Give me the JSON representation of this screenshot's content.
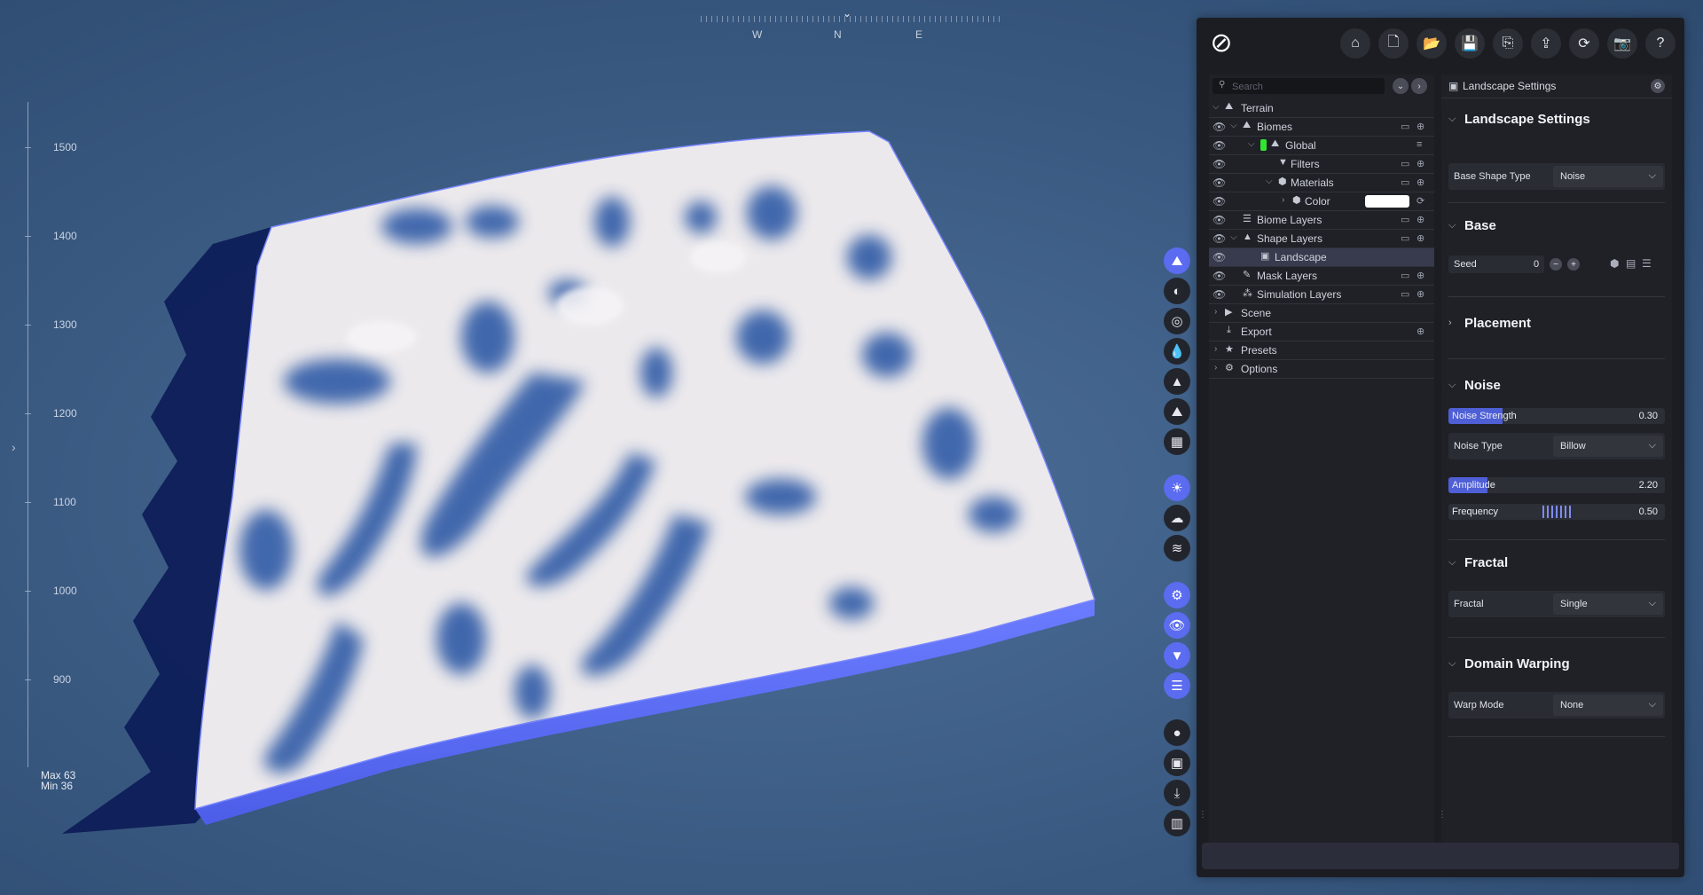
{
  "viewport": {
    "compass": {
      "west": "W",
      "north": "N",
      "east": "E"
    },
    "ruler_ticks": [
      "1500",
      "1400",
      "1300",
      "1200",
      "1100",
      "1000",
      "900"
    ],
    "max_label": "Max 63",
    "min_label": "Min 36"
  },
  "toolbar": {
    "buttons": [
      "home-icon",
      "new-file-icon",
      "open-folder-icon",
      "save-icon",
      "save-as-icon",
      "export-icon",
      "refresh-icon",
      "camera-icon",
      "help-icon"
    ]
  },
  "tree": {
    "search_placeholder": "Search",
    "items": [
      {
        "label": "Terrain"
      },
      {
        "label": "Biomes"
      },
      {
        "label": "Global"
      },
      {
        "label": "Filters"
      },
      {
        "label": "Materials"
      },
      {
        "label": "Color"
      },
      {
        "label": "Biome Layers"
      },
      {
        "label": "Shape Layers"
      },
      {
        "label": "Landscape"
      },
      {
        "label": "Mask Layers"
      },
      {
        "label": "Simulation Layers"
      },
      {
        "label": "Scene"
      },
      {
        "label": "Export"
      },
      {
        "label": "Presets"
      },
      {
        "label": "Options"
      }
    ]
  },
  "settings": {
    "header": "Landscape Settings",
    "landscape": {
      "title": "Landscape Settings",
      "base_shape_label": "Base Shape Type",
      "base_shape_value": "Noise"
    },
    "base": {
      "title": "Base",
      "seed_label": "Seed",
      "seed_value": "0"
    },
    "placement": {
      "title": "Placement"
    },
    "noise": {
      "title": "Noise",
      "strength_label": "Noise Strength",
      "strength_value": "0.30",
      "strength_level": 0.25,
      "type_label": "Noise Type",
      "type_value": "Billow",
      "amplitude_label": "Amplitude",
      "amplitude_value": "2.20",
      "amplitude_level": 0.18,
      "frequency_label": "Frequency",
      "frequency_value": "0.50"
    },
    "fractal": {
      "title": "Fractal",
      "label": "Fractal",
      "value": "Single"
    },
    "warping": {
      "title": "Domain Warping",
      "label": "Warp Mode",
      "value": "None"
    }
  },
  "colors": {
    "accent": "#5b6cf0",
    "terrain_edge": "#5f72f5",
    "green_chip": "#33e533"
  }
}
